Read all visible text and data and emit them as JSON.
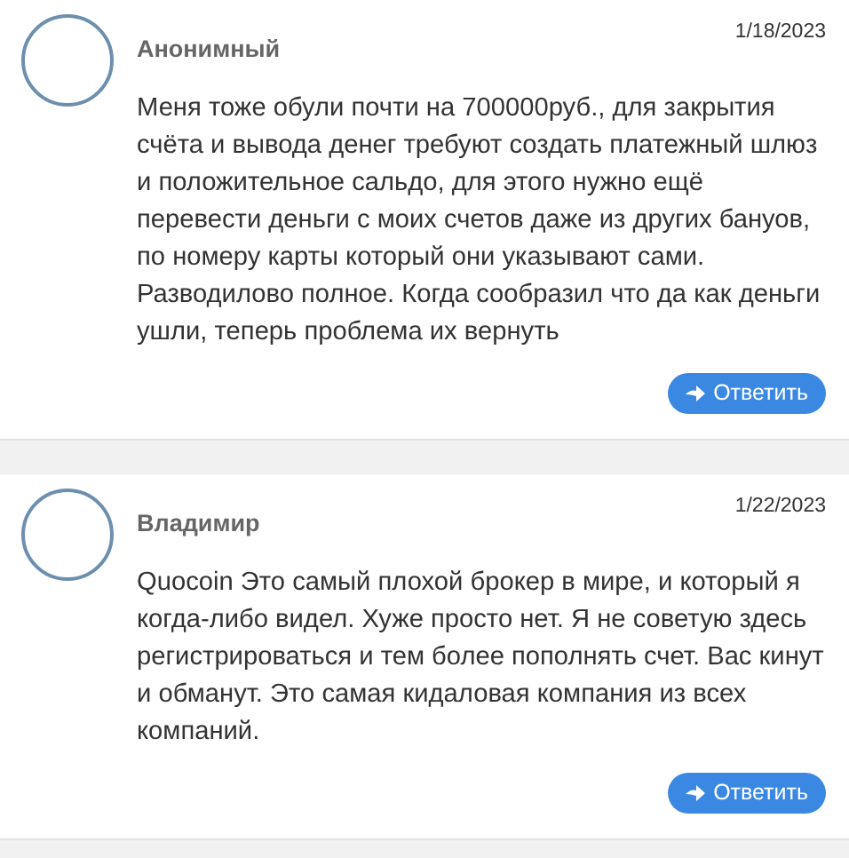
{
  "comments": [
    {
      "author": "Анонимный",
      "date": "1/18/2023",
      "text": "Меня тоже обули почти на 700000руб., для закрытия счёта и вывода денег требуют создать платежный шлюз и положительное сальдо, для этого нужно ещё перевести деньги с моих счетов даже из других бануов, по номеру карты который они указывают сами. Разводилово полное. Когда сообразил что да как деньги ушли, теперь проблема их вернуть",
      "reply_label": "Ответить"
    },
    {
      "author": "Владимир",
      "date": "1/22/2023",
      "text": "Quocoin Это самый плохой брокер в мире, и который я когда-либо видел. Хуже просто нет. Я не советую здесь регистрироваться и тем более пополнять счет. Вас кинут и обманут. Это самая кидаловая компания из всех компаний.",
      "reply_label": "Ответить"
    }
  ]
}
